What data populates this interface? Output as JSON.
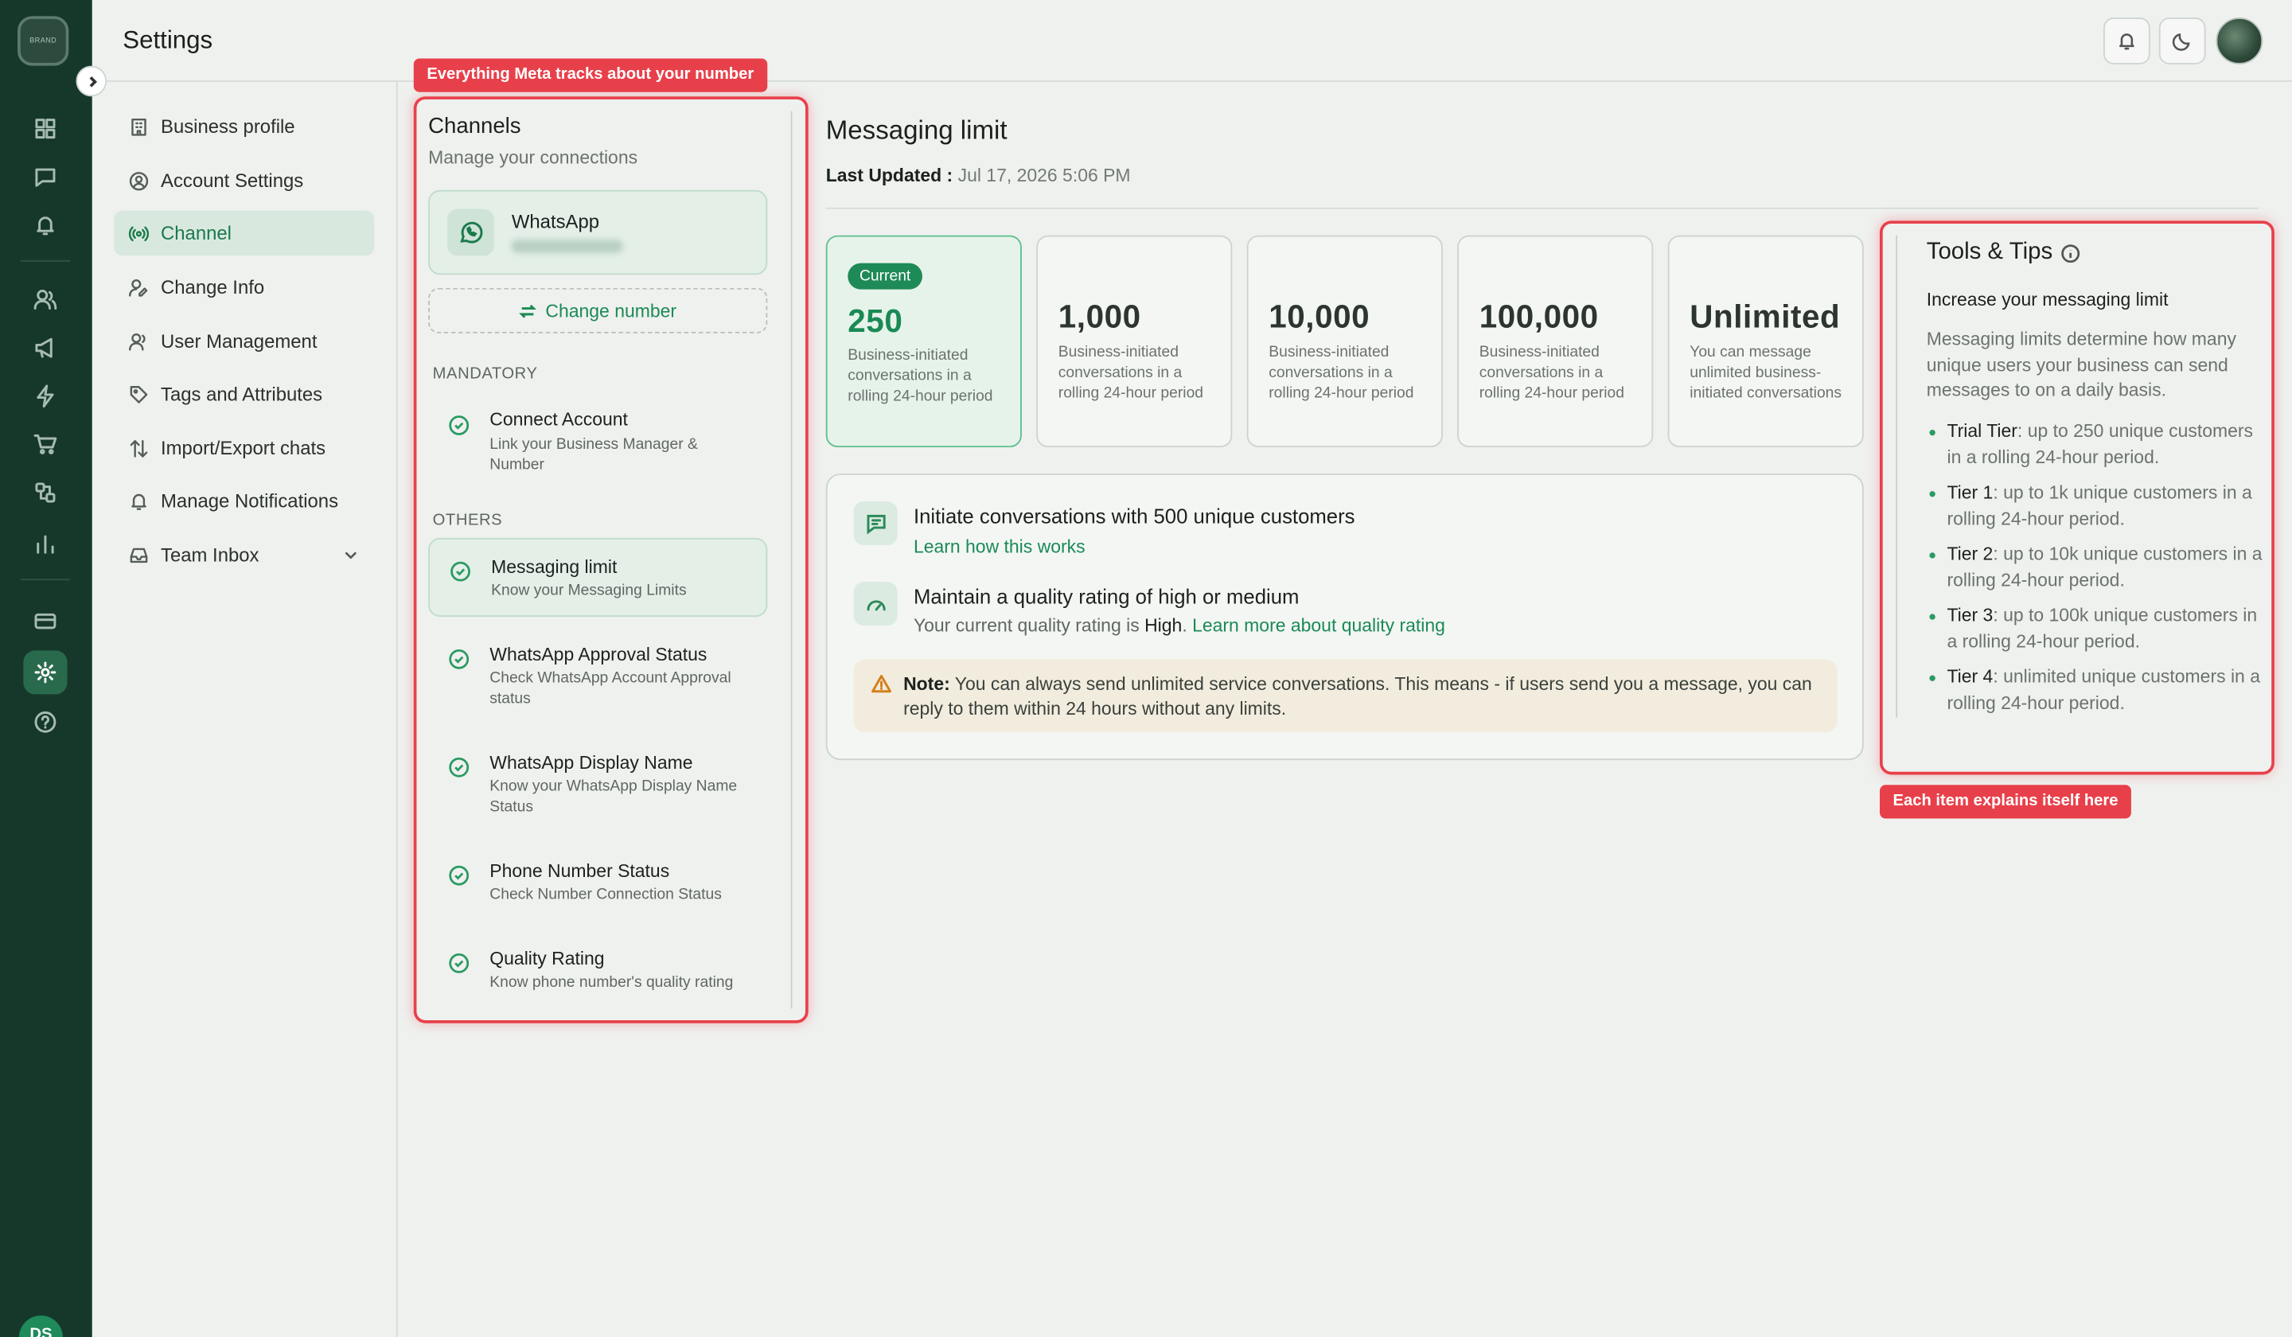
{
  "header": {
    "title": "Settings"
  },
  "rail": {
    "logo_text": "BRAND",
    "avatar_initials": "DS"
  },
  "nav": [
    {
      "label": "Business profile",
      "icon": "building-icon"
    },
    {
      "label": "Account Settings",
      "icon": "user-circle-icon"
    },
    {
      "label": "Channel",
      "icon": "broadcast-icon",
      "active": true
    },
    {
      "label": "Change Info",
      "icon": "user-edit-icon"
    },
    {
      "label": "User Management",
      "icon": "users-icon"
    },
    {
      "label": "Tags and Attributes",
      "icon": "tag-icon"
    },
    {
      "label": "Import/Export chats",
      "icon": "arrows-updown-icon"
    },
    {
      "label": "Manage Notifications",
      "icon": "bell-icon"
    },
    {
      "label": "Team Inbox",
      "icon": "inbox-icon",
      "has_dropdown": true
    }
  ],
  "channels": {
    "title": "Channels",
    "subtitle": "Manage your connections",
    "whatsapp_label": "WhatsApp",
    "change_number": "Change number",
    "mandatory_label": "MANDATORY",
    "others_label": "OTHERS",
    "mandatory": [
      {
        "title": "Connect Account",
        "desc": "Link your Business Manager & Number"
      }
    ],
    "others": [
      {
        "title": "Messaging limit",
        "desc": "Know your Messaging Limits",
        "active": true
      },
      {
        "title": "WhatsApp Approval Status",
        "desc": "Check WhatsApp Account Approval status"
      },
      {
        "title": "WhatsApp Display Name",
        "desc": "Know your WhatsApp Display Name Status"
      },
      {
        "title": "Phone Number Status",
        "desc": "Check Number Connection Status"
      },
      {
        "title": "Quality Rating",
        "desc": "Know phone number's quality rating"
      }
    ]
  },
  "messaging": {
    "title": "Messaging limit",
    "updated_label": "Last Updated :",
    "updated_value": "Jul 17, 2026 5:06 PM",
    "current_badge": "Current",
    "tiers": [
      {
        "value": "250",
        "desc": "Business-initiated conversations in a rolling 24-hour period",
        "current": true
      },
      {
        "value": "1,000",
        "desc": "Business-initiated conversations in a rolling 24-hour period"
      },
      {
        "value": "10,000",
        "desc": "Business-initiated conversations in a rolling 24-hour period"
      },
      {
        "value": "100,000",
        "desc": "Business-initiated conversations in a rolling 24-hour period"
      },
      {
        "value": "Unlimited",
        "desc": "You can message unlimited business-initiated conversations"
      }
    ],
    "initiate_title": "Initiate conversations with 500 unique customers",
    "initiate_link": "Learn how this works",
    "quality_title": "Maintain a quality rating of high or medium",
    "quality_text": "Your current quality rating is",
    "quality_value": "High",
    "quality_link": "Learn more about quality rating",
    "note_label": "Note:",
    "note_text": "You can always send unlimited service conversations. This means - if users send you a message, you can reply to them within 24 hours without any limits."
  },
  "tips": {
    "title": "Tools & Tips",
    "subtitle": "Increase your messaging limit",
    "body": "Messaging limits determine how many unique users your business can send messages to on a daily basis.",
    "items": [
      {
        "tier": "Trial Tier",
        "text": ": up to 250 unique customers in a rolling 24-hour period."
      },
      {
        "tier": "Tier 1",
        "text": ": up to 1k unique customers in a rolling 24-hour period."
      },
      {
        "tier": "Tier 2",
        "text": ": up to 10k unique customers in a rolling 24-hour period."
      },
      {
        "tier": "Tier 3",
        "text": ": up to 100k unique customers in a rolling 24-hour period."
      },
      {
        "tier": "Tier 4",
        "text": ": unlimited unique customers in a rolling 24-hour period."
      }
    ]
  },
  "callouts": {
    "channels": "Everything Meta tracks about your number",
    "tips": "Each item explains itself here"
  },
  "colors": {
    "brand_dark": "#16382b",
    "accent": "#1a8a55",
    "highlight": "#e8404a"
  }
}
